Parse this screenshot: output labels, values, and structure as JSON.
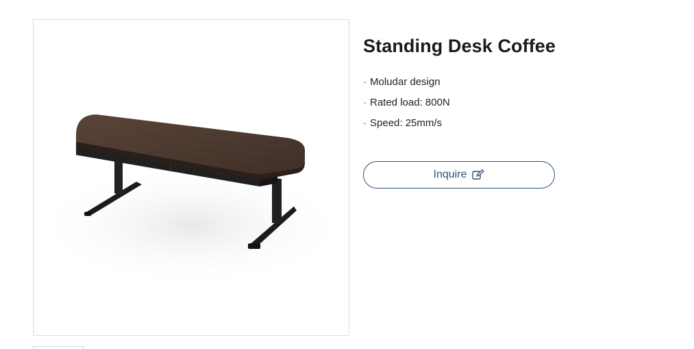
{
  "product": {
    "title": "Standing Desk Coffee",
    "image_alt": "standing desk coffee table with walnut top and black legs",
    "features": [
      "Moludar design",
      "Rated load: 800N",
      "Speed: 25mm/s"
    ],
    "bullet": "·"
  },
  "actions": {
    "inquire_label": "Inquire",
    "inquire_icon": "edit-icon"
  },
  "colors": {
    "accent": "#2d4f73",
    "desktop_wood": "#4e3a30",
    "frame_black": "#1e1e1e"
  }
}
